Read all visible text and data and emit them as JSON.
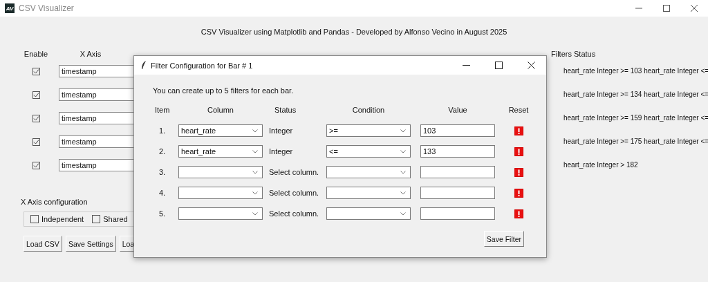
{
  "window": {
    "title": "CSV Visualizer",
    "app_badge": "AV"
  },
  "header": "CSV Visualizer using Matplotlib and Pandas - Developed by Alfonso Vecino in August 2025",
  "columns": {
    "enable": "Enable",
    "x_axis": "X Axis",
    "filters_status": "Filters Status"
  },
  "bars": [
    {
      "enabled": true,
      "x_axis": "timestamp",
      "filters_status": "heart_rate Integer >= 103 heart_rate Integer <="
    },
    {
      "enabled": true,
      "x_axis": "timestamp",
      "filters_status": "heart_rate Integer >= 134 heart_rate Integer <="
    },
    {
      "enabled": true,
      "x_axis": "timestamp",
      "filters_status": "heart_rate Integer >= 159 heart_rate Integer <="
    },
    {
      "enabled": true,
      "x_axis": "timestamp",
      "filters_status": "heart_rate Integer >= 175 heart_rate Integer <="
    },
    {
      "enabled": true,
      "x_axis": "timestamp",
      "filters_status": "heart_rate Integer > 182"
    }
  ],
  "x_axis_config": {
    "title": "X Axis configuration",
    "options": [
      {
        "label": "Independent",
        "checked": false
      },
      {
        "label": "Shared",
        "checked": false
      }
    ]
  },
  "buttons": [
    "Load CSV",
    "Save Settings",
    "Loa"
  ],
  "dialog": {
    "title": "Filter Configuration for Bar # 1",
    "intro": "You can create up to 5 filters for each bar.",
    "headers": [
      "Item",
      "Column",
      "Status",
      "Condition",
      "Value",
      "Reset"
    ],
    "filters": [
      {
        "item": "1.",
        "column": "heart_rate",
        "status": "Integer",
        "condition": ">=",
        "value": "103"
      },
      {
        "item": "2.",
        "column": "heart_rate",
        "status": "Integer",
        "condition": "<=",
        "value": "133"
      },
      {
        "item": "3.",
        "status": "Select column."
      },
      {
        "item": "4.",
        "status": "Select column."
      },
      {
        "item": "5.",
        "status": "Select column."
      }
    ],
    "save_button": "Save Filter"
  }
}
